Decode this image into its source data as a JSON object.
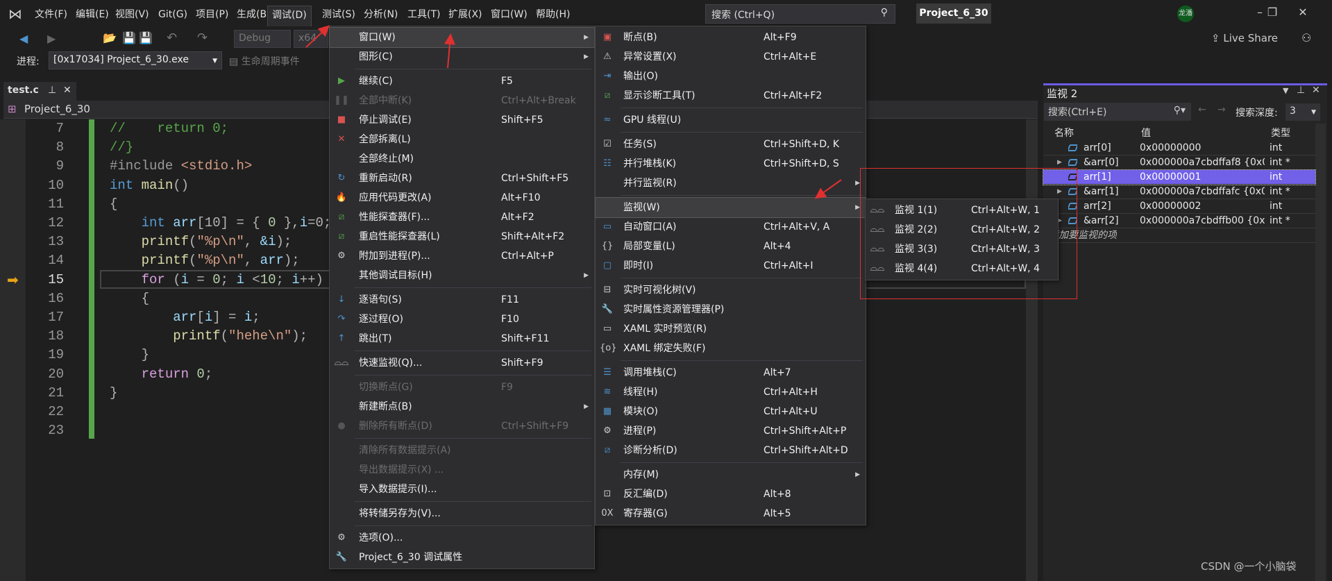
{
  "menubar": {
    "items": [
      "文件(F)",
      "编辑(E)",
      "视图(V)",
      "Git(G)",
      "项目(P)",
      "生成(B)",
      "调试(D)",
      "测试(S)",
      "分析(N)",
      "工具(T)",
      "扩展(X)",
      "窗口(W)",
      "帮助(H)"
    ],
    "active_index": 6
  },
  "search": {
    "placeholder": "搜索 (Ctrl+Q)"
  },
  "title": "Project_6_30",
  "user": "龙潘",
  "toolbar": {
    "config": "Debug",
    "platform": "x64",
    "live_share": "Live Share",
    "process_label": "进程:",
    "process": "[0x17034] Project_6_30.exe",
    "lifecycle": "生命周期事件"
  },
  "editor": {
    "tab": "test.c",
    "nav": "Project_6_30",
    "current_line": 15,
    "lines": [
      {
        "n": 7,
        "t": [
          [
            "//    return 0;",
            "cm"
          ]
        ]
      },
      {
        "n": 8,
        "t": [
          [
            "//}",
            "cm"
          ]
        ]
      },
      {
        "n": 9,
        "t": [
          [
            "#include ",
            "pp"
          ],
          [
            "<stdio.h>",
            "st"
          ]
        ]
      },
      {
        "n": 10,
        "t": [
          [
            "int ",
            "kw"
          ],
          [
            "main",
            "fn"
          ],
          [
            "()",
            "pu"
          ]
        ]
      },
      {
        "n": 11,
        "t": [
          [
            "{",
            "pu"
          ]
        ]
      },
      {
        "n": 12,
        "t": [
          [
            "    int ",
            "kw"
          ],
          [
            "arr",
            "va"
          ],
          [
            "[10] = { ",
            "pu"
          ],
          [
            "0",
            "nm"
          ],
          [
            " },",
            "pu"
          ],
          [
            "i",
            "va"
          ],
          [
            "=0;",
            "pu"
          ]
        ]
      },
      {
        "n": 13,
        "t": [
          [
            "    printf",
            "fn"
          ],
          [
            "(",
            "pu"
          ],
          [
            "\"%p\\n\"",
            "st"
          ],
          [
            ", ",
            "pu"
          ],
          [
            "&i",
            "va"
          ],
          [
            ");",
            "pu"
          ]
        ]
      },
      {
        "n": 14,
        "t": [
          [
            "    printf",
            "fn"
          ],
          [
            "(",
            "pu"
          ],
          [
            "\"%p\\n\"",
            "st"
          ],
          [
            ", ",
            "pu"
          ],
          [
            "arr",
            "va"
          ],
          [
            ");",
            "pu"
          ]
        ]
      },
      {
        "n": 15,
        "t": [
          [
            "    for ",
            "ct"
          ],
          [
            "(",
            "pu"
          ],
          [
            "i",
            "va"
          ],
          [
            " = ",
            "pu"
          ],
          [
            "0",
            "nm"
          ],
          [
            "; ",
            "pu"
          ],
          [
            "i",
            "va"
          ],
          [
            " <",
            "pu"
          ],
          [
            "10",
            "nm"
          ],
          [
            "; ",
            "pu"
          ],
          [
            "i",
            "va"
          ],
          [
            "++)",
            "pu"
          ]
        ]
      },
      {
        "n": 16,
        "t": [
          [
            "    {",
            "pu"
          ]
        ]
      },
      {
        "n": 17,
        "t": [
          [
            "        arr",
            "va"
          ],
          [
            "[",
            "pu"
          ],
          [
            "i",
            "va"
          ],
          [
            "] = ",
            "pu"
          ],
          [
            "i",
            "va"
          ],
          [
            ";",
            "pu"
          ]
        ]
      },
      {
        "n": 18,
        "t": [
          [
            "        printf",
            "fn"
          ],
          [
            "(",
            "pu"
          ],
          [
            "\"hehe\\n\"",
            "st"
          ],
          [
            ");",
            "pu"
          ]
        ]
      },
      {
        "n": 19,
        "t": [
          [
            "    }",
            "pu"
          ]
        ]
      },
      {
        "n": 20,
        "t": [
          [
            "    return ",
            "ct"
          ],
          [
            "0",
            "nm"
          ],
          [
            ";",
            "pu"
          ]
        ]
      },
      {
        "n": 21,
        "t": [
          [
            "}",
            "pu"
          ]
        ]
      },
      {
        "n": 22,
        "t": []
      },
      {
        "n": 23,
        "t": []
      }
    ]
  },
  "debug_menu": [
    {
      "label": "窗口(W)",
      "sub": true,
      "hl": true
    },
    {
      "label": "图形(C)",
      "sub": true
    },
    {
      "sep": true
    },
    {
      "label": "继续(C)",
      "key": "F5",
      "icon": "play-icon"
    },
    {
      "label": "全部中断(K)",
      "key": "Ctrl+Alt+Break",
      "dis": true,
      "icon": "pause-icon"
    },
    {
      "label": "停止调试(E)",
      "key": "Shift+F5",
      "icon": "stop-icon"
    },
    {
      "label": "全部拆离(L)",
      "icon": "detach-icon"
    },
    {
      "label": "全部终止(M)"
    },
    {
      "label": "重新启动(R)",
      "key": "Ctrl+Shift+F5",
      "icon": "restart-icon"
    },
    {
      "label": "应用代码更改(A)",
      "key": "Alt+F10",
      "icon": "apply-changes-icon"
    },
    {
      "label": "性能探查器(F)...",
      "key": "Alt+F2",
      "icon": "profiler-icon"
    },
    {
      "label": "重启性能探查器(L)",
      "key": "Shift+Alt+F2",
      "icon": "profiler-icon"
    },
    {
      "label": "附加到进程(P)...",
      "key": "Ctrl+Alt+P",
      "icon": "attach-icon"
    },
    {
      "label": "其他调试目标(H)",
      "sub": true
    },
    {
      "sep": true
    },
    {
      "label": "逐语句(S)",
      "key": "F11",
      "icon": "step-into-icon"
    },
    {
      "label": "逐过程(O)",
      "key": "F10",
      "icon": "step-over-icon"
    },
    {
      "label": "跳出(T)",
      "key": "Shift+F11",
      "icon": "step-out-icon"
    },
    {
      "sep": true
    },
    {
      "label": "快速监视(Q)...",
      "key": "Shift+F9",
      "icon": "quickwatch-icon"
    },
    {
      "sep": true
    },
    {
      "label": "切换断点(G)",
      "key": "F9",
      "dis": true
    },
    {
      "label": "新建断点(B)",
      "sub": true
    },
    {
      "label": "删除所有断点(D)",
      "key": "Ctrl+Shift+F9",
      "dis": true,
      "icon": "delete-breakpoints-icon"
    },
    {
      "sep": true
    },
    {
      "label": "清除所有数据提示(A)",
      "dis": true
    },
    {
      "label": "导出数据提示(X) ...",
      "dis": true
    },
    {
      "label": "导入数据提示(I)..."
    },
    {
      "sep": true
    },
    {
      "label": "将转储另存为(V)..."
    },
    {
      "sep": true
    },
    {
      "label": "选项(O)...",
      "icon": "gear-icon"
    },
    {
      "label": "Project_6_30 调试属性",
      "icon": "wrench-icon"
    }
  ],
  "window_menu": [
    {
      "label": "断点(B)",
      "key": "Alt+F9",
      "icon": "breakpoints-icon"
    },
    {
      "label": "异常设置(X)",
      "key": "Ctrl+Alt+E",
      "icon": "exception-icon"
    },
    {
      "label": "输出(O)",
      "icon": "output-icon"
    },
    {
      "label": "显示诊断工具(T)",
      "key": "Ctrl+Alt+F2",
      "icon": "diagnostics-icon"
    },
    {
      "sep": true
    },
    {
      "label": "GPU 线程(U)",
      "icon": "gpu-threads-icon"
    },
    {
      "sep": true
    },
    {
      "label": "任务(S)",
      "key": "Ctrl+Shift+D, K",
      "icon": "tasks-icon"
    },
    {
      "label": "并行堆栈(K)",
      "key": "Ctrl+Shift+D, S",
      "icon": "parallel-stacks-icon"
    },
    {
      "label": "并行监视(R)",
      "sub": true
    },
    {
      "sep": true
    },
    {
      "label": "监视(W)",
      "sub": true,
      "hl": true
    },
    {
      "label": "自动窗口(A)",
      "key": "Ctrl+Alt+V, A",
      "icon": "autos-icon"
    },
    {
      "label": "局部变量(L)",
      "key": "Alt+4",
      "icon": "locals-icon"
    },
    {
      "label": "即时(I)",
      "key": "Ctrl+Alt+I",
      "icon": "immediate-icon"
    },
    {
      "sep": true
    },
    {
      "label": "实时可视化树(V)",
      "icon": "visual-tree-icon"
    },
    {
      "label": "实时属性资源管理器(P)",
      "icon": "property-explorer-icon"
    },
    {
      "label": "XAML 实时预览(R)",
      "icon": "xaml-preview-icon"
    },
    {
      "label": "XAML 绑定失败(F)",
      "icon": "xaml-binding-icon"
    },
    {
      "sep": true
    },
    {
      "label": "调用堆栈(C)",
      "key": "Alt+7",
      "icon": "call-stack-icon"
    },
    {
      "label": "线程(H)",
      "key": "Ctrl+Alt+H",
      "icon": "threads-icon"
    },
    {
      "label": "模块(O)",
      "key": "Ctrl+Alt+U",
      "icon": "modules-icon"
    },
    {
      "label": "进程(P)",
      "key": "Ctrl+Shift+Alt+P",
      "icon": "processes-icon"
    },
    {
      "label": "诊断分析(D)",
      "key": "Ctrl+Shift+Alt+D",
      "icon": "diagnostic-analysis-icon"
    },
    {
      "sep": true
    },
    {
      "label": "内存(M)",
      "sub": true
    },
    {
      "label": "反汇编(D)",
      "key": "Alt+8",
      "icon": "disassembly-icon"
    },
    {
      "label": "寄存器(G)",
      "key": "Alt+5",
      "icon": "registers-icon"
    }
  ],
  "watch_menu": [
    {
      "label": "监视 1(1)",
      "key": "Ctrl+Alt+W, 1",
      "icon": "watch-icon"
    },
    {
      "label": "监视 2(2)",
      "key": "Ctrl+Alt+W, 2",
      "icon": "watch-icon"
    },
    {
      "label": "监视 3(3)",
      "key": "Ctrl+Alt+W, 3",
      "icon": "watch-icon"
    },
    {
      "label": "监视 4(4)",
      "key": "Ctrl+Alt+W, 4",
      "icon": "watch-icon"
    }
  ],
  "watch_panel": {
    "title": "监视 2",
    "search_placeholder": "搜索(Ctrl+E)",
    "depth_label": "搜索深度:",
    "depth": "3",
    "columns": [
      "名称",
      "值",
      "类型"
    ],
    "rows": [
      {
        "name": "arr[0]",
        "value": "0x00000000",
        "type": "int",
        "expand": false
      },
      {
        "name": "&arr[0]",
        "value": "0x000000a7cbdffaf8 {0x0...",
        "type": "int *",
        "expand": true
      },
      {
        "name": "arr[1]",
        "value": "0x00000001",
        "type": "int",
        "expand": false,
        "selected": true
      },
      {
        "name": "&arr[1]",
        "value": "0x000000a7cbdffafc {0x00...",
        "type": "int *",
        "expand": true
      },
      {
        "name": "arr[2]",
        "value": "0x00000002",
        "type": "int",
        "expand": false
      },
      {
        "name": "&arr[2]",
        "value": "0x000000a7cbdffb00 {0x0...",
        "type": "int *",
        "expand": true
      }
    ],
    "add_item": "添加要监视的项"
  },
  "watermark": "CSDN @一个小脑袋",
  "colors": {
    "accent": "#6b5ce7",
    "selection": "#7160e8",
    "annotation": "#e03030",
    "change_bar": "#57a64a"
  }
}
